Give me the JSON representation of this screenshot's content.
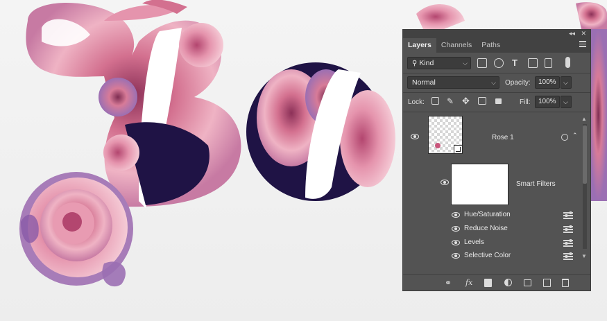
{
  "canvas": {
    "letters": [
      "B",
      "o"
    ],
    "colors": {
      "rose_pink": "#d3708f",
      "rose_light": "#efb3c4",
      "rose_dark": "#8c3158",
      "navy": "#1f1345",
      "violet": "#7a4e9a",
      "background": "#f2f2f2"
    }
  },
  "panel": {
    "window_controls": {
      "collapse": "◂◂",
      "close": "✕"
    },
    "tabs": [
      {
        "label": "Layers",
        "active": true
      },
      {
        "label": "Channels",
        "active": false
      },
      {
        "label": "Paths",
        "active": false
      }
    ],
    "filter": {
      "kind_label": "Kind",
      "icons": [
        "image-filter-icon",
        "adjustment-filter-icon",
        "type-filter-icon",
        "shape-filter-icon",
        "smart-object-filter-icon",
        "filter-toggle-icon"
      ]
    },
    "blend": {
      "mode": "Normal",
      "opacity_label": "Opacity:",
      "opacity_value": "100%"
    },
    "lock": {
      "label": "Lock:",
      "fill_label": "Fill:",
      "fill_value": "100%",
      "icons": [
        "lock-transparent-icon",
        "lock-image-icon",
        "lock-position-icon",
        "lock-artboard-icon",
        "lock-all-icon"
      ]
    },
    "layers": {
      "main": {
        "name": "Rose 1",
        "visible": true
      },
      "smart_filters": {
        "name": "Smart Filters",
        "visible": true
      },
      "filters": [
        {
          "name": "Hue/Saturation",
          "visible": true
        },
        {
          "name": "Reduce Noise",
          "visible": true
        },
        {
          "name": "Levels",
          "visible": true
        },
        {
          "name": "Selective Color",
          "visible": true
        }
      ]
    },
    "bottom_icons": [
      "link-layers-icon",
      "fx-icon",
      "add-mask-icon",
      "adjustment-layer-icon",
      "new-group-icon",
      "new-layer-icon",
      "delete-layer-icon"
    ],
    "fx_label": "fx"
  }
}
